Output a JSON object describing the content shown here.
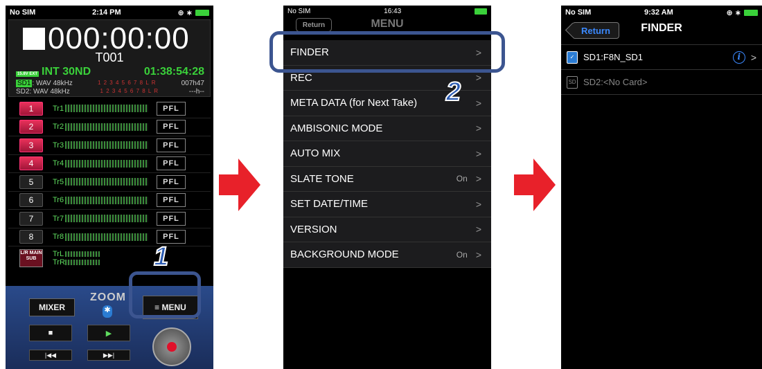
{
  "screen1": {
    "status": {
      "carrier": "No SIM",
      "time": "2:14 PM",
      "icons": "⊕ ∗"
    },
    "timecode": "000:00:00",
    "take": "T001",
    "int_label": "INT 30ND",
    "battery_label": "15.8V EXT",
    "remaining": "01:38:54:28",
    "sd1": {
      "name": "SD1",
      "format": ": WAV 48kHz",
      "tracks": "1 2 3 4 5 6 7 8 L R",
      "time": "007h47"
    },
    "sd2": {
      "name": "SD2",
      "format": ": WAV 48kHz",
      "tracks": "1 2 3 4 5 6 7 8 L R",
      "time": "---h--"
    },
    "tracks": [
      {
        "num": "1",
        "label": "Tr1",
        "armed": true
      },
      {
        "num": "2",
        "label": "Tr2",
        "armed": true
      },
      {
        "num": "3",
        "label": "Tr3",
        "armed": true
      },
      {
        "num": "4",
        "label": "Tr4",
        "armed": true
      },
      {
        "num": "5",
        "label": "Tr5",
        "armed": false
      },
      {
        "num": "6",
        "label": "Tr6",
        "armed": false
      },
      {
        "num": "7",
        "label": "Tr7",
        "armed": false
      },
      {
        "num": "8",
        "label": "Tr8",
        "armed": false
      }
    ],
    "pfl_label": "PFL",
    "lr_label": "L/R MAIN SUB",
    "trl": "TrL",
    "trr": "TrR",
    "mixer_label": "MIXER",
    "brand": "ZOOM",
    "menu_label": "≡ MENU",
    "step": "1"
  },
  "screen2": {
    "status": {
      "carrier": "No SIM",
      "time": "16:43"
    },
    "back_label": "Return",
    "title": "MENU",
    "items": [
      {
        "label": "FINDER",
        "value": ""
      },
      {
        "label": "REC",
        "value": ""
      },
      {
        "label": "META DATA (for Next Take)",
        "value": ""
      },
      {
        "label": "AMBISONIC MODE",
        "value": ""
      },
      {
        "label": "AUTO MIX",
        "value": ""
      },
      {
        "label": "SLATE TONE",
        "value": "On"
      },
      {
        "label": "SET DATE/TIME",
        "value": ""
      },
      {
        "label": "VERSION",
        "value": ""
      },
      {
        "label": "BACKGROUND MODE",
        "value": "On"
      }
    ],
    "step": "2"
  },
  "screen3": {
    "status": {
      "carrier": "No SIM",
      "time": "9:32 AM",
      "icons": "⊕ ∗"
    },
    "return_label": "Return",
    "title": "FINDER",
    "rows": [
      {
        "label": "SD1:F8N_SD1"
      },
      {
        "label": "SD2:<No Card>"
      }
    ]
  },
  "colors": {
    "highlight": "#3c5590",
    "arrow": "#e8212a",
    "ios_blue": "#3b89ff",
    "meter_green": "#3a8c3a"
  }
}
